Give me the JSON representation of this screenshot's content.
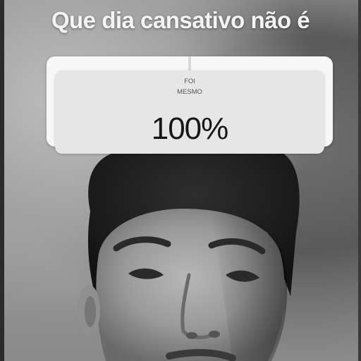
{
  "story": {
    "caption": "Que dia cansativo não é"
  },
  "sticker": {
    "question_line1": "FOI",
    "question_line2": "MESMO",
    "result_percent": "100%",
    "result_value": 100
  },
  "colors": {
    "caption_text": "#f4f4f4",
    "sticker_background": "#f7f7f7",
    "sticker_card": "#e6e6e6",
    "percent_text": "#161616"
  }
}
